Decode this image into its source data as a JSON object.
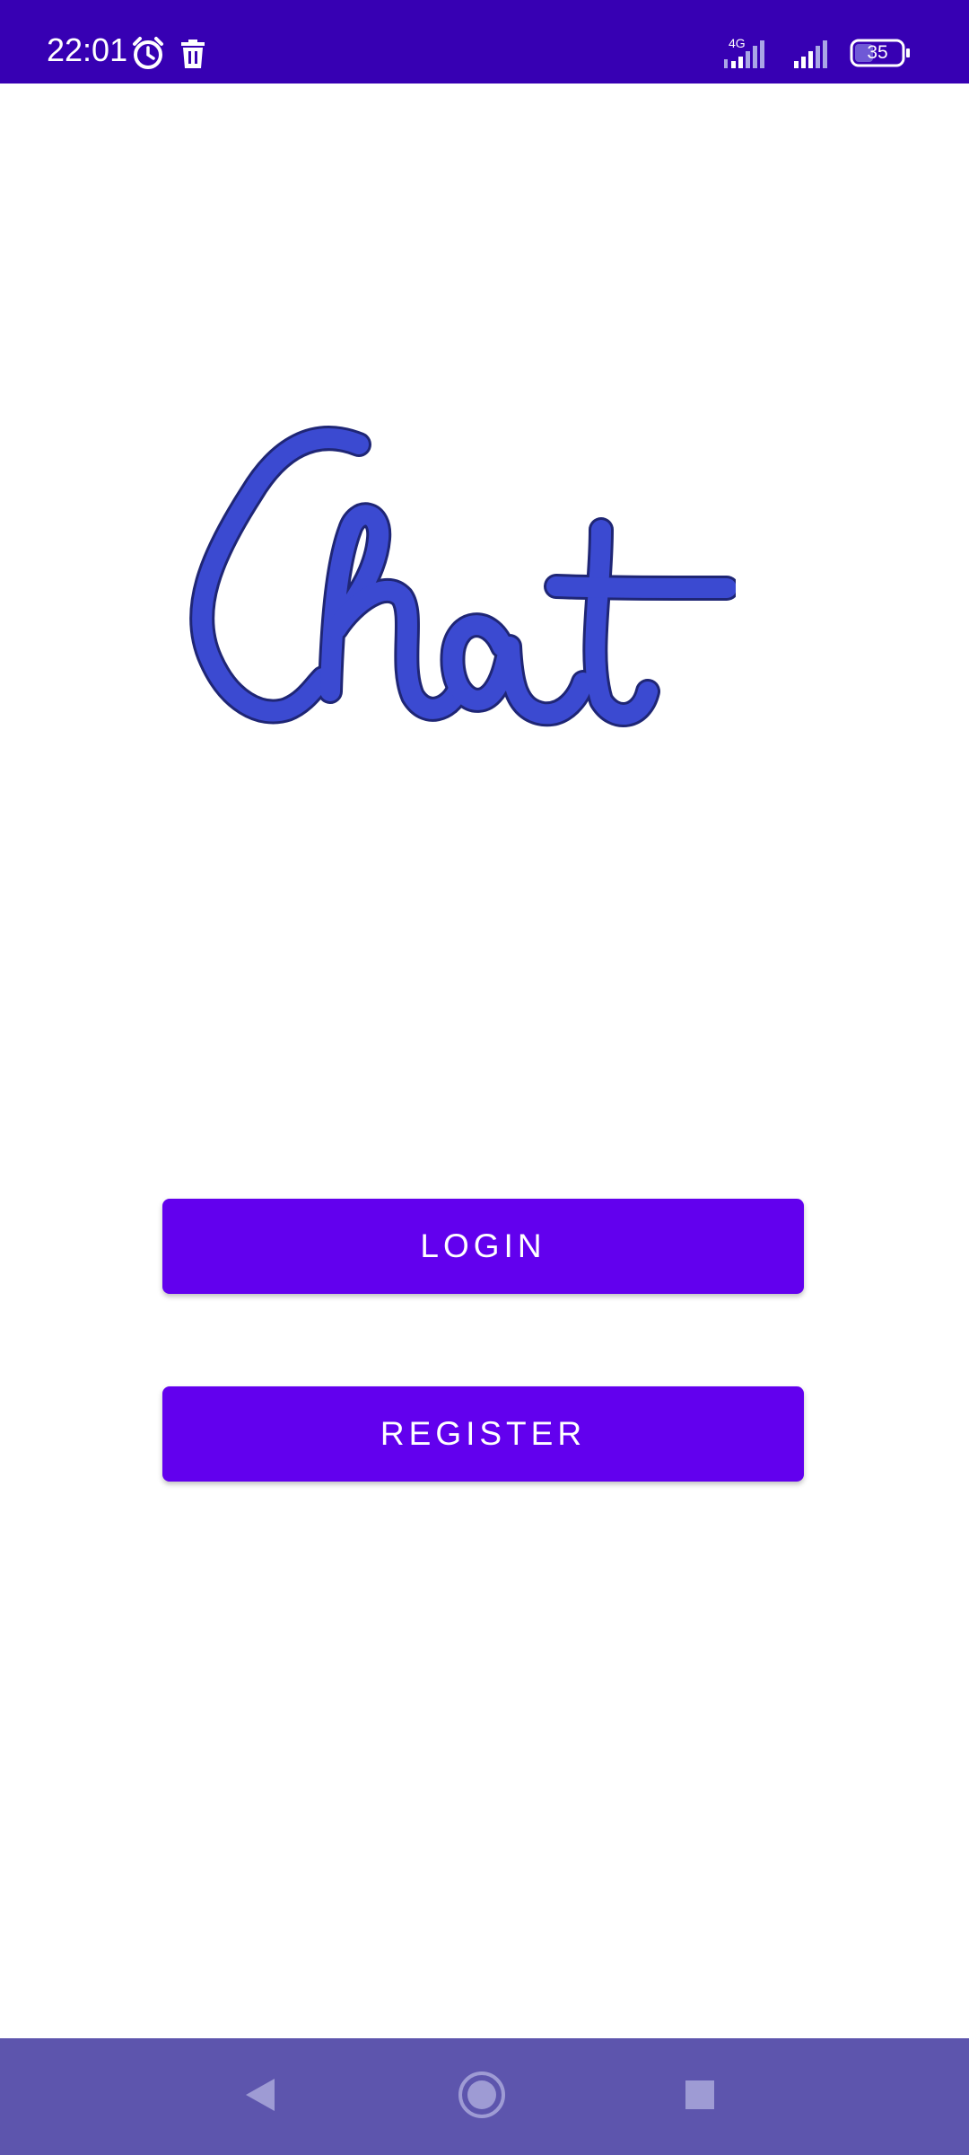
{
  "status_bar": {
    "time": "22:01",
    "network_type": "4G",
    "battery_level": "35",
    "background_color": "#3700b3",
    "icons": [
      "alarm-icon",
      "trash-icon",
      "signal-icon",
      "battery-icon"
    ]
  },
  "logo": {
    "text": "Chat",
    "color": "#3b4ad1"
  },
  "buttons": {
    "login_label": "LOGIN",
    "register_label": "REGISTER",
    "color": "#6200ee"
  },
  "nav_bar": {
    "background_color": "#5d55ad",
    "icons": [
      "back-icon",
      "home-icon",
      "recents-icon"
    ]
  }
}
